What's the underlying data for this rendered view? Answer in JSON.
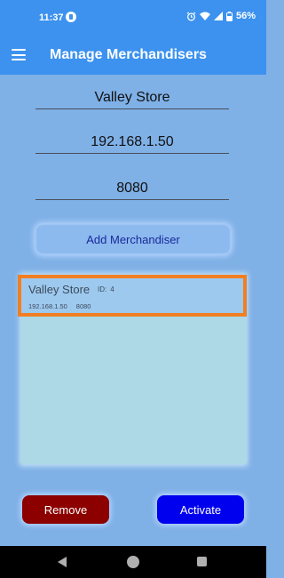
{
  "status_bar": {
    "time": "11:37",
    "battery": "56%",
    "icons": [
      "alarm-icon",
      "wifi-icon",
      "signal-icon",
      "battery-icon"
    ]
  },
  "app_bar": {
    "title": "Manage Merchandisers",
    "menu_icon": "hamburger-menu-icon"
  },
  "form": {
    "name_value": "Valley Store",
    "ip_value": "192.168.1.50",
    "port_value": "8080",
    "add_button_label": "Add Merchandiser"
  },
  "merchandisers": [
    {
      "name": "Valley Store",
      "id_label": "ID:",
      "id": "4",
      "ip": "192.168.1.50",
      "port": "8080",
      "selected": true
    }
  ],
  "actions": {
    "remove_label": "Remove",
    "activate_label": "Activate"
  },
  "colors": {
    "app_bar": "#3c92ee",
    "background": "#7fb0e6",
    "list_panel": "#add8e6",
    "selection_border": "#f17f22",
    "remove_button": "#8c0000",
    "activate_button": "#0000ee"
  }
}
